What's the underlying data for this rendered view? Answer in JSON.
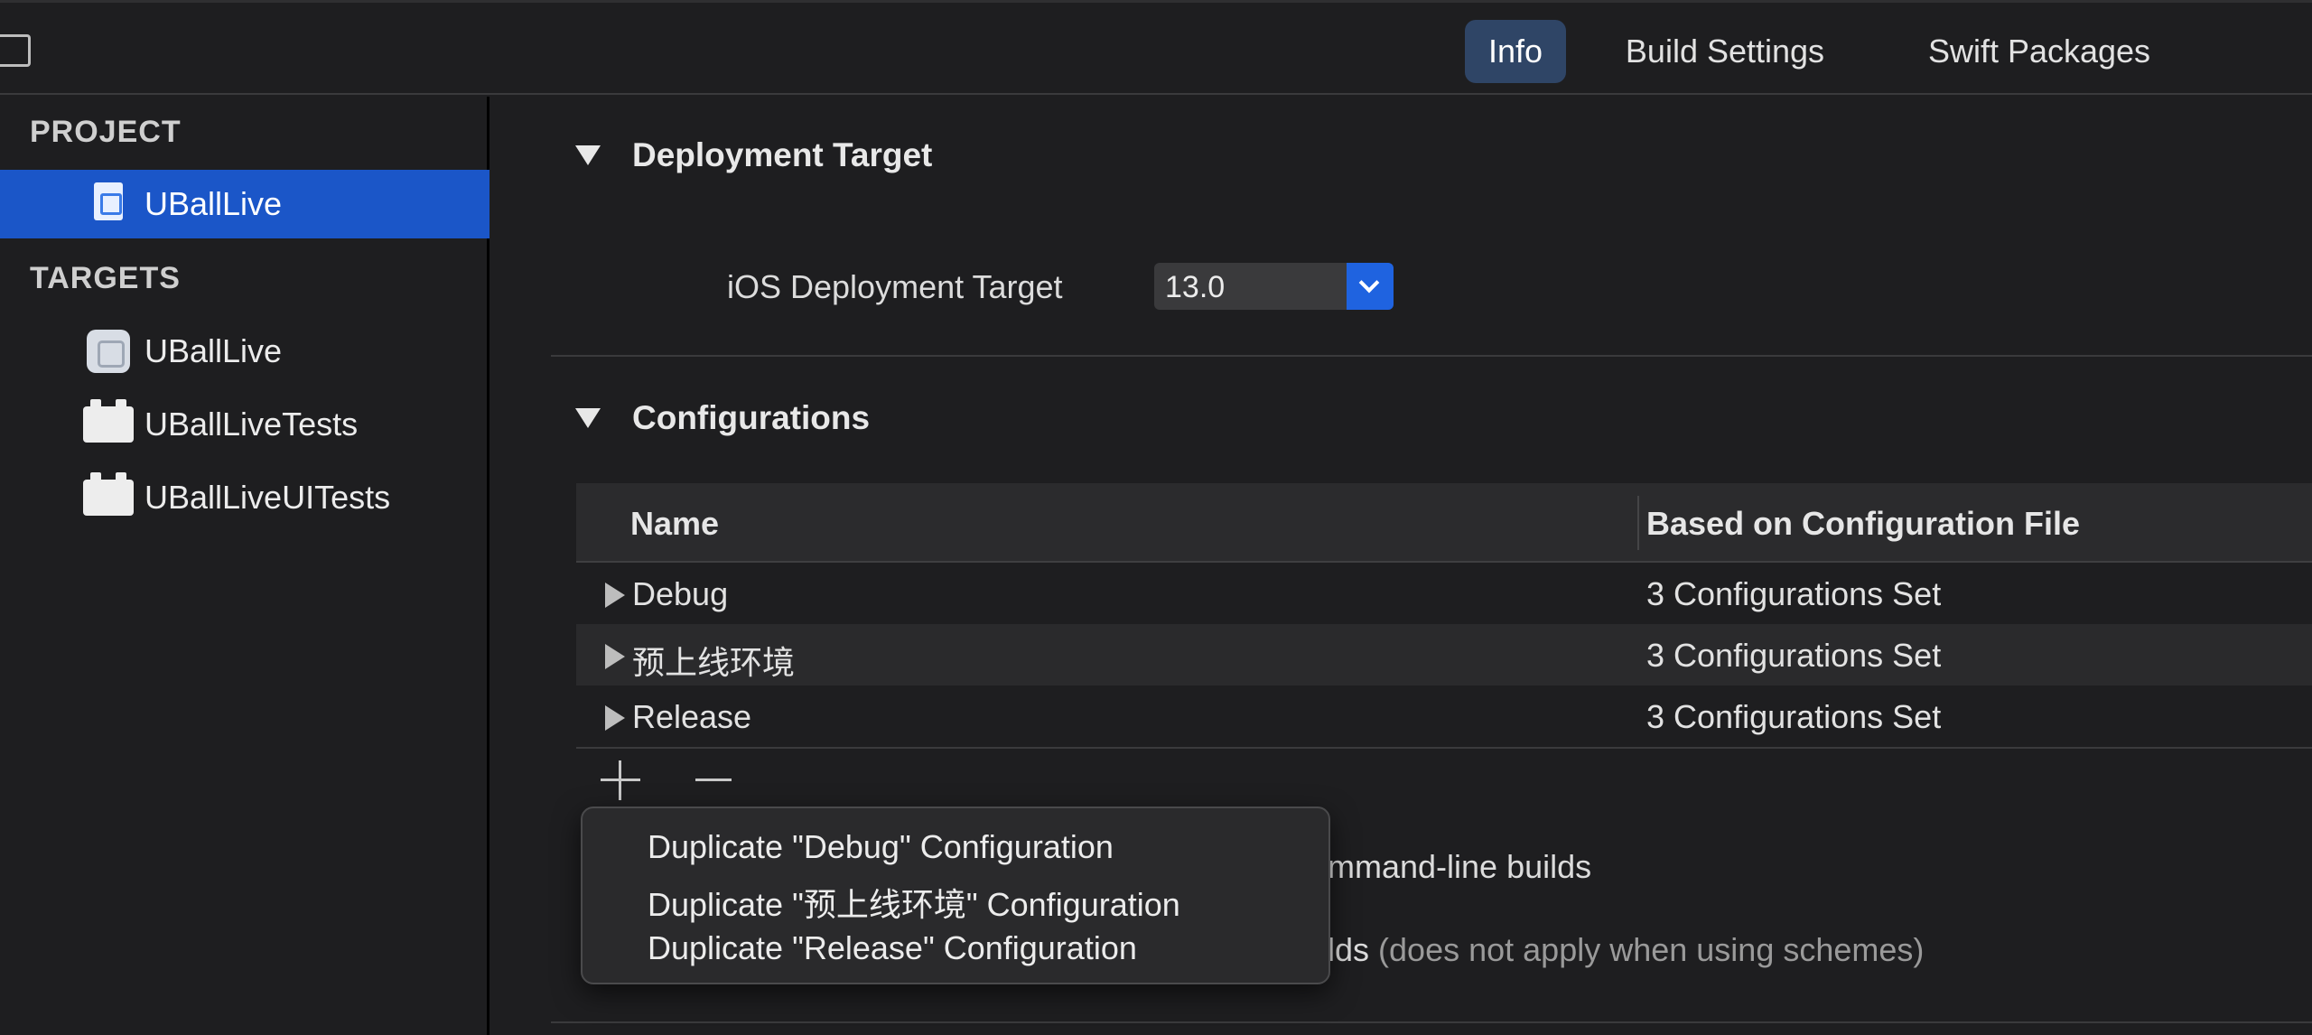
{
  "tabs": [
    {
      "label": "Info"
    },
    {
      "label": "Build Settings"
    },
    {
      "label": "Swift Packages"
    }
  ],
  "sidebar": {
    "project_header": "PROJECT",
    "targets_header": "TARGETS",
    "project_item": "UBallLive",
    "targets": [
      {
        "label": "UBallLive"
      },
      {
        "label": "UBallLiveTests"
      },
      {
        "label": "UBallLiveUITests"
      }
    ]
  },
  "deployment": {
    "title": "Deployment Target",
    "label": "iOS Deployment Target",
    "value": "13.0"
  },
  "configurations": {
    "title": "Configurations",
    "columns": [
      "Name",
      "Based on Configuration File"
    ],
    "rows": [
      {
        "name": "Debug",
        "based": "3 Configurations Set"
      },
      {
        "name": "预上线环境",
        "based": "3 Configurations Set"
      },
      {
        "name": "Release",
        "based": "3 Configurations Set"
      }
    ]
  },
  "background_text": {
    "line1": "mmand-line builds",
    "line2_main": "lds",
    "line2_dim": "(does not apply when using schemes)"
  },
  "menu": {
    "items": [
      {
        "label": "Duplicate \"Debug\" Configuration"
      },
      {
        "label": "Duplicate \"预上线环境\" Configuration"
      },
      {
        "label": "Duplicate \"Release\" Configuration"
      }
    ]
  },
  "colors": {
    "accent": "#1b56c8",
    "active_tab": "#2f4566",
    "background": "#1e1e20"
  }
}
